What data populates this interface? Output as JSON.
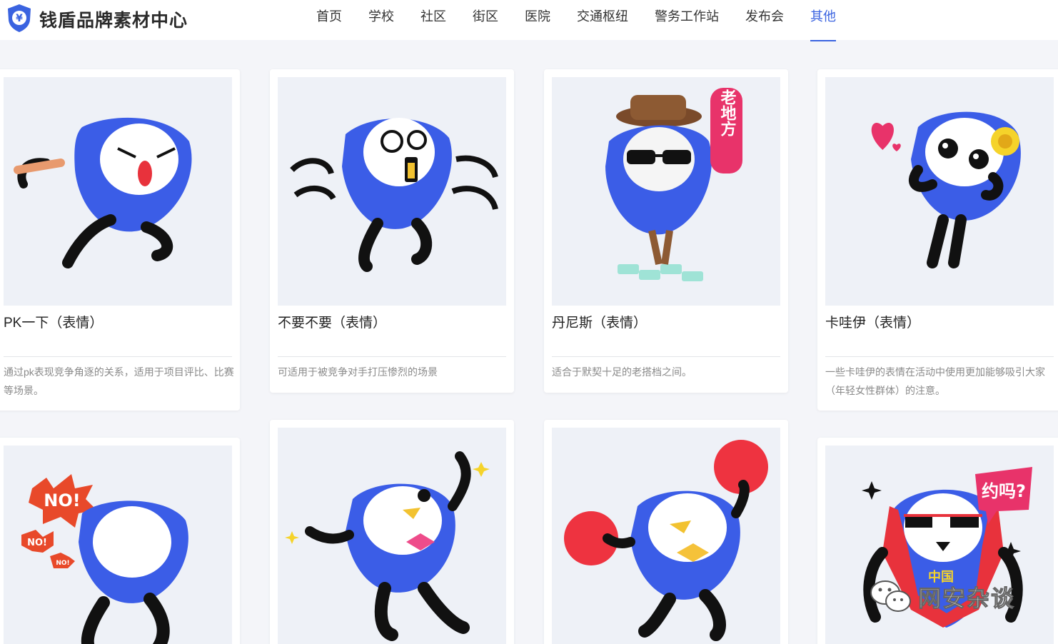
{
  "header": {
    "brand": "钱盾品牌素材中心",
    "logo_glyph": "¥",
    "brand_color": "#3a63e0",
    "nav": [
      "首页",
      "学校",
      "社区",
      "街区",
      "医院",
      "交通枢纽",
      "警务工作站",
      "发布会",
      "其他"
    ],
    "active_nav": "其他"
  },
  "cards": [
    {
      "title": "PK一下（表情）",
      "desc": "通过pk表现竞争角逐的关系，适用于项目评比、比赛等场景。"
    },
    {
      "title": "不要不要（表情）",
      "desc": "可适用于被竞争对手打压惨烈的场景"
    },
    {
      "title": "丹尼斯（表情）",
      "desc": "适合于默契十足的老搭档之间。"
    },
    {
      "title": "卡哇伊（表情）",
      "desc": "一些卡哇伊的表情在活动中使用更加能够吸引大家（年轻女性群体）的注意。"
    },
    {
      "title": "",
      "desc": ""
    },
    {
      "title": "",
      "desc": ""
    },
    {
      "title": "",
      "desc": ""
    },
    {
      "title": "",
      "desc": ""
    }
  ],
  "sticker_text": {
    "laodifang": "老地方",
    "no_big": "NO!",
    "no_mid": "NO!",
    "no_small": "NO!",
    "yuema": "约吗?",
    "zhongguo": "中国"
  },
  "colors": {
    "mascot_blue": "#3b5de7",
    "accent_red": "#e8323c"
  },
  "watermark": {
    "text": "网安杂谈",
    "icon": "wechat-icon"
  }
}
